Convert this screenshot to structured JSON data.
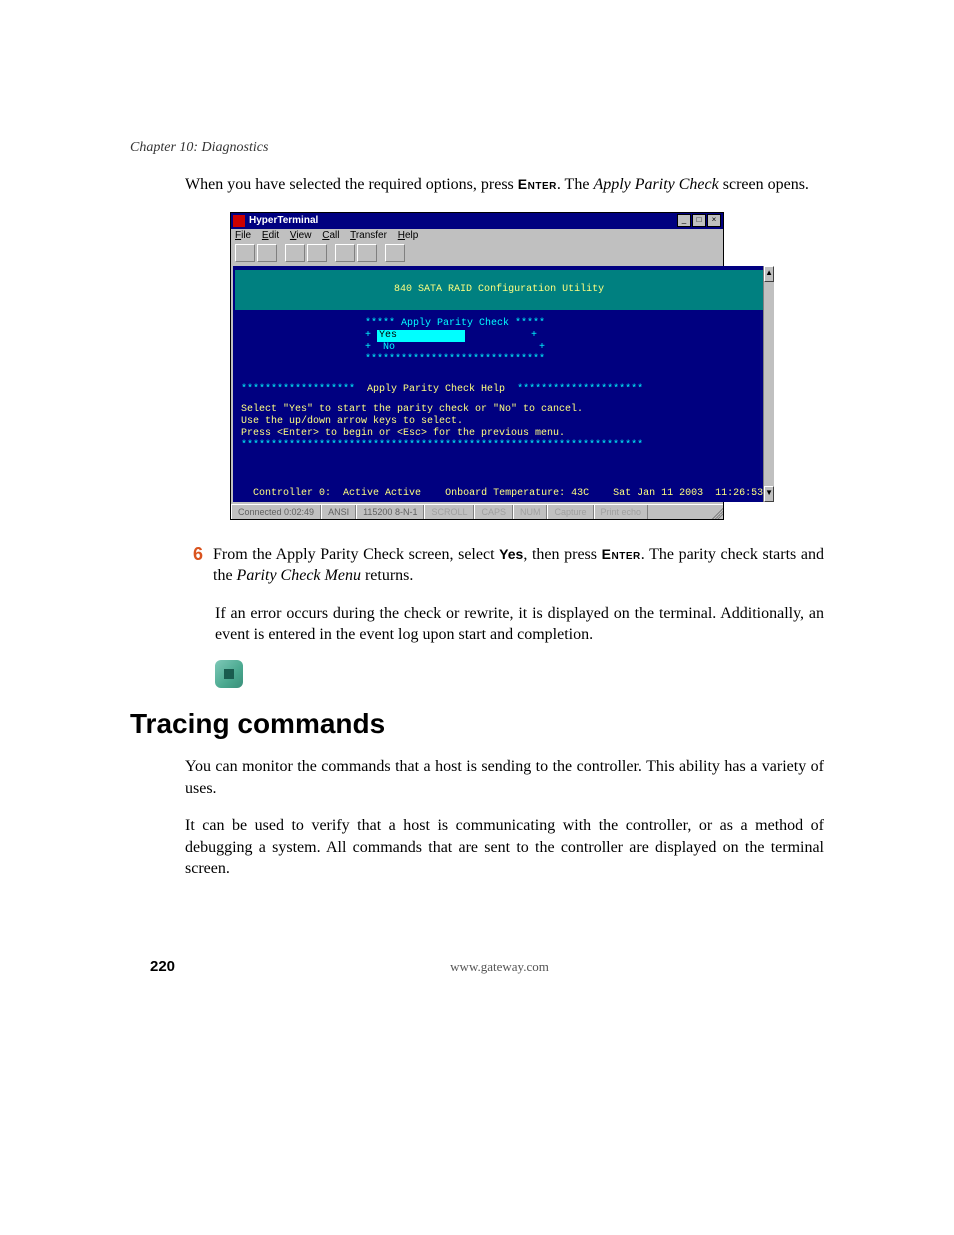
{
  "chapter_header": "Chapter 10: Diagnostics",
  "para1_a": "When you have selected the required options, press ",
  "para1_enter": "Enter",
  "para1_b": ". The ",
  "para1_italic": "Apply Parity Check",
  "para1_c": " screen opens.",
  "step6_num": "6",
  "step6_a": "From the Apply Parity Check screen, select ",
  "step6_yes": "Yes",
  "step6_b": ", then press ",
  "step6_enter": "Enter",
  "step6_c": ". The parity check starts and the ",
  "step6_italic": "Parity Check Menu",
  "step6_d": " returns.",
  "step6_err": "If an error occurs during the check or rewrite, it is displayed on the terminal. Additionally, an event is entered in the event log upon start and completion.",
  "heading": "Tracing commands",
  "trace_p1": "You can monitor the commands that a host is sending to the controller. This ability has a variety of uses.",
  "trace_p2": "It can be used to verify that a host is communicating with the controller, or as a method of debugging a system. All commands that are sent to the controller are displayed on the terminal screen.",
  "footer_page": "220",
  "footer_url": "www.gateway.com",
  "ht": {
    "title": "HyperTerminal",
    "menu": {
      "file": "File",
      "edit": "Edit",
      "view": "View",
      "call": "Call",
      "transfer": "Transfer",
      "help": "Help"
    },
    "banner": "840 SATA RAID Configuration Utility",
    "apc_top": "***** Apply Parity Check *****",
    "apc_yes": "Yes",
    "apc_no": "+  No                        +",
    "apc_bot": "******************************",
    "help_hdr_l": "*******************",
    "help_hdr_t": "  Apply Parity Check Help  ",
    "help_hdr_r": "*********************",
    "help1": "Select \"Yes\" to start the parity check or \"No\" to cancel.",
    "help2": "Use the up/down arrow keys to select.",
    "help3": "Press <Enter> to begin or <Esc> for the previous menu.",
    "help_bot": "*******************************************************************",
    "status_ctrl": "Controller 0:  Active Active",
    "status_temp": "Onboard Temperature: 43C",
    "status_date": "Sat Jan 11 2003  11:26:53",
    "sb_conn": "Connected 0:02:49",
    "sb_emul": "ANSI",
    "sb_speed": "115200 8-N-1",
    "sb_scroll": "SCROLL",
    "sb_caps": "CAPS",
    "sb_num": "NUM",
    "sb_cap": "Capture",
    "sb_echo": "Print echo"
  }
}
